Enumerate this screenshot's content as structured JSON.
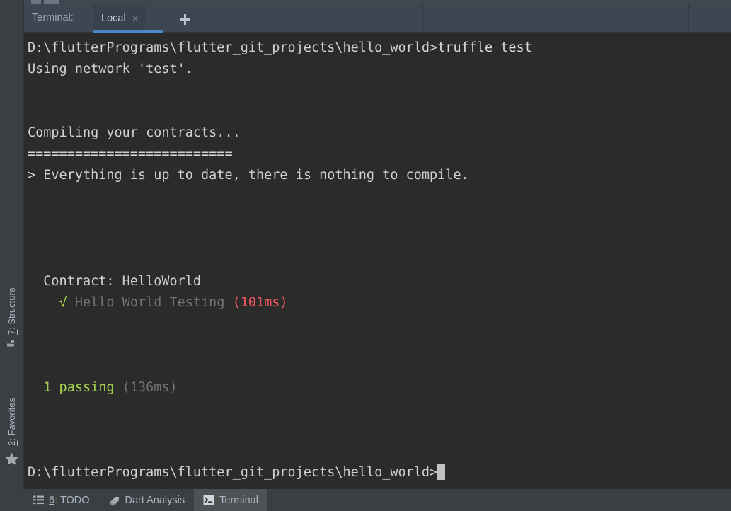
{
  "window": {
    "background_color": "#3c3f41",
    "terminal_background": "#2b2b2b",
    "accent_color": "#4a88c7"
  },
  "left_strip": {
    "items": [
      {
        "label": "7: Structure",
        "mnemonic": "7",
        "icon": "structure-icon"
      },
      {
        "label": "2: Favorites",
        "mnemonic": "2",
        "icon": "star-icon"
      }
    ]
  },
  "terminal_header": {
    "title": "Terminal:",
    "tabs": [
      {
        "label": "Local",
        "active": true,
        "close_label": "×"
      }
    ],
    "add_tab_label": "+"
  },
  "terminal": {
    "prompt_path": "D:\\flutterPrograms\\flutter_git_projects\\hello_world>",
    "lines": [
      {
        "id": "cmd-line",
        "segments": [
          {
            "text": "D:\\flutterPrograms\\flutter_git_projects\\hello_world>",
            "color": "default"
          },
          {
            "text": "truffle test",
            "color": "white"
          }
        ]
      },
      {
        "id": "using-network",
        "segments": [
          {
            "text": "Using network 'test'.",
            "color": "default"
          }
        ]
      },
      {
        "id": "blank-1",
        "segments": [
          {
            "text": "",
            "color": "default"
          }
        ]
      },
      {
        "id": "blank-2",
        "segments": [
          {
            "text": "",
            "color": "default"
          }
        ]
      },
      {
        "id": "compiling",
        "segments": [
          {
            "text": "Compiling your contracts...",
            "color": "default"
          }
        ]
      },
      {
        "id": "separator",
        "segments": [
          {
            "text": "==========================",
            "color": "default"
          }
        ]
      },
      {
        "id": "up-to-date",
        "segments": [
          {
            "text": "> Everything is up to date, there is nothing to compile.",
            "color": "default"
          }
        ]
      },
      {
        "id": "blank-3",
        "segments": [
          {
            "text": "",
            "color": "default"
          }
        ]
      },
      {
        "id": "blank-4",
        "segments": [
          {
            "text": "",
            "color": "default"
          }
        ]
      },
      {
        "id": "blank-5",
        "segments": [
          {
            "text": "",
            "color": "default"
          }
        ]
      },
      {
        "id": "blank-6",
        "segments": [
          {
            "text": "",
            "color": "default"
          }
        ]
      },
      {
        "id": "contract-name",
        "segments": [
          {
            "text": "  Contract: HelloWorld",
            "color": "default"
          }
        ]
      },
      {
        "id": "test-case",
        "segments": [
          {
            "text": "    ",
            "color": "default"
          },
          {
            "text": "√",
            "color": "green"
          },
          {
            "text": " Hello World Testing ",
            "color": "dim"
          },
          {
            "text": "(101ms)",
            "color": "red"
          }
        ]
      },
      {
        "id": "blank-7",
        "segments": [
          {
            "text": "",
            "color": "default"
          }
        ]
      },
      {
        "id": "blank-8",
        "segments": [
          {
            "text": "",
            "color": "default"
          }
        ]
      },
      {
        "id": "blank-9",
        "segments": [
          {
            "text": "",
            "color": "default"
          }
        ]
      },
      {
        "id": "summary",
        "segments": [
          {
            "text": "  ",
            "color": "default"
          },
          {
            "text": "1 passing",
            "color": "green"
          },
          {
            "text": " (136ms)",
            "color": "dim"
          }
        ]
      },
      {
        "id": "blank-10",
        "segments": [
          {
            "text": "",
            "color": "default"
          }
        ]
      },
      {
        "id": "blank-11",
        "segments": [
          {
            "text": "",
            "color": "default"
          }
        ]
      },
      {
        "id": "blank-12",
        "segments": [
          {
            "text": "",
            "color": "default"
          }
        ]
      },
      {
        "id": "final-prompt",
        "cursor": true,
        "segments": [
          {
            "text": "D:\\flutterPrograms\\flutter_git_projects\\hello_world>",
            "color": "default"
          }
        ]
      }
    ]
  },
  "status_bar": {
    "items": [
      {
        "label": "6: TODO",
        "mnemonic": "6",
        "icon": "list-icon",
        "active": false
      },
      {
        "label": "Dart Analysis",
        "mnemonic": "",
        "icon": "dart-icon",
        "active": false
      },
      {
        "label": "Terminal",
        "mnemonic": "",
        "icon": "terminal-icon",
        "active": true
      }
    ]
  }
}
